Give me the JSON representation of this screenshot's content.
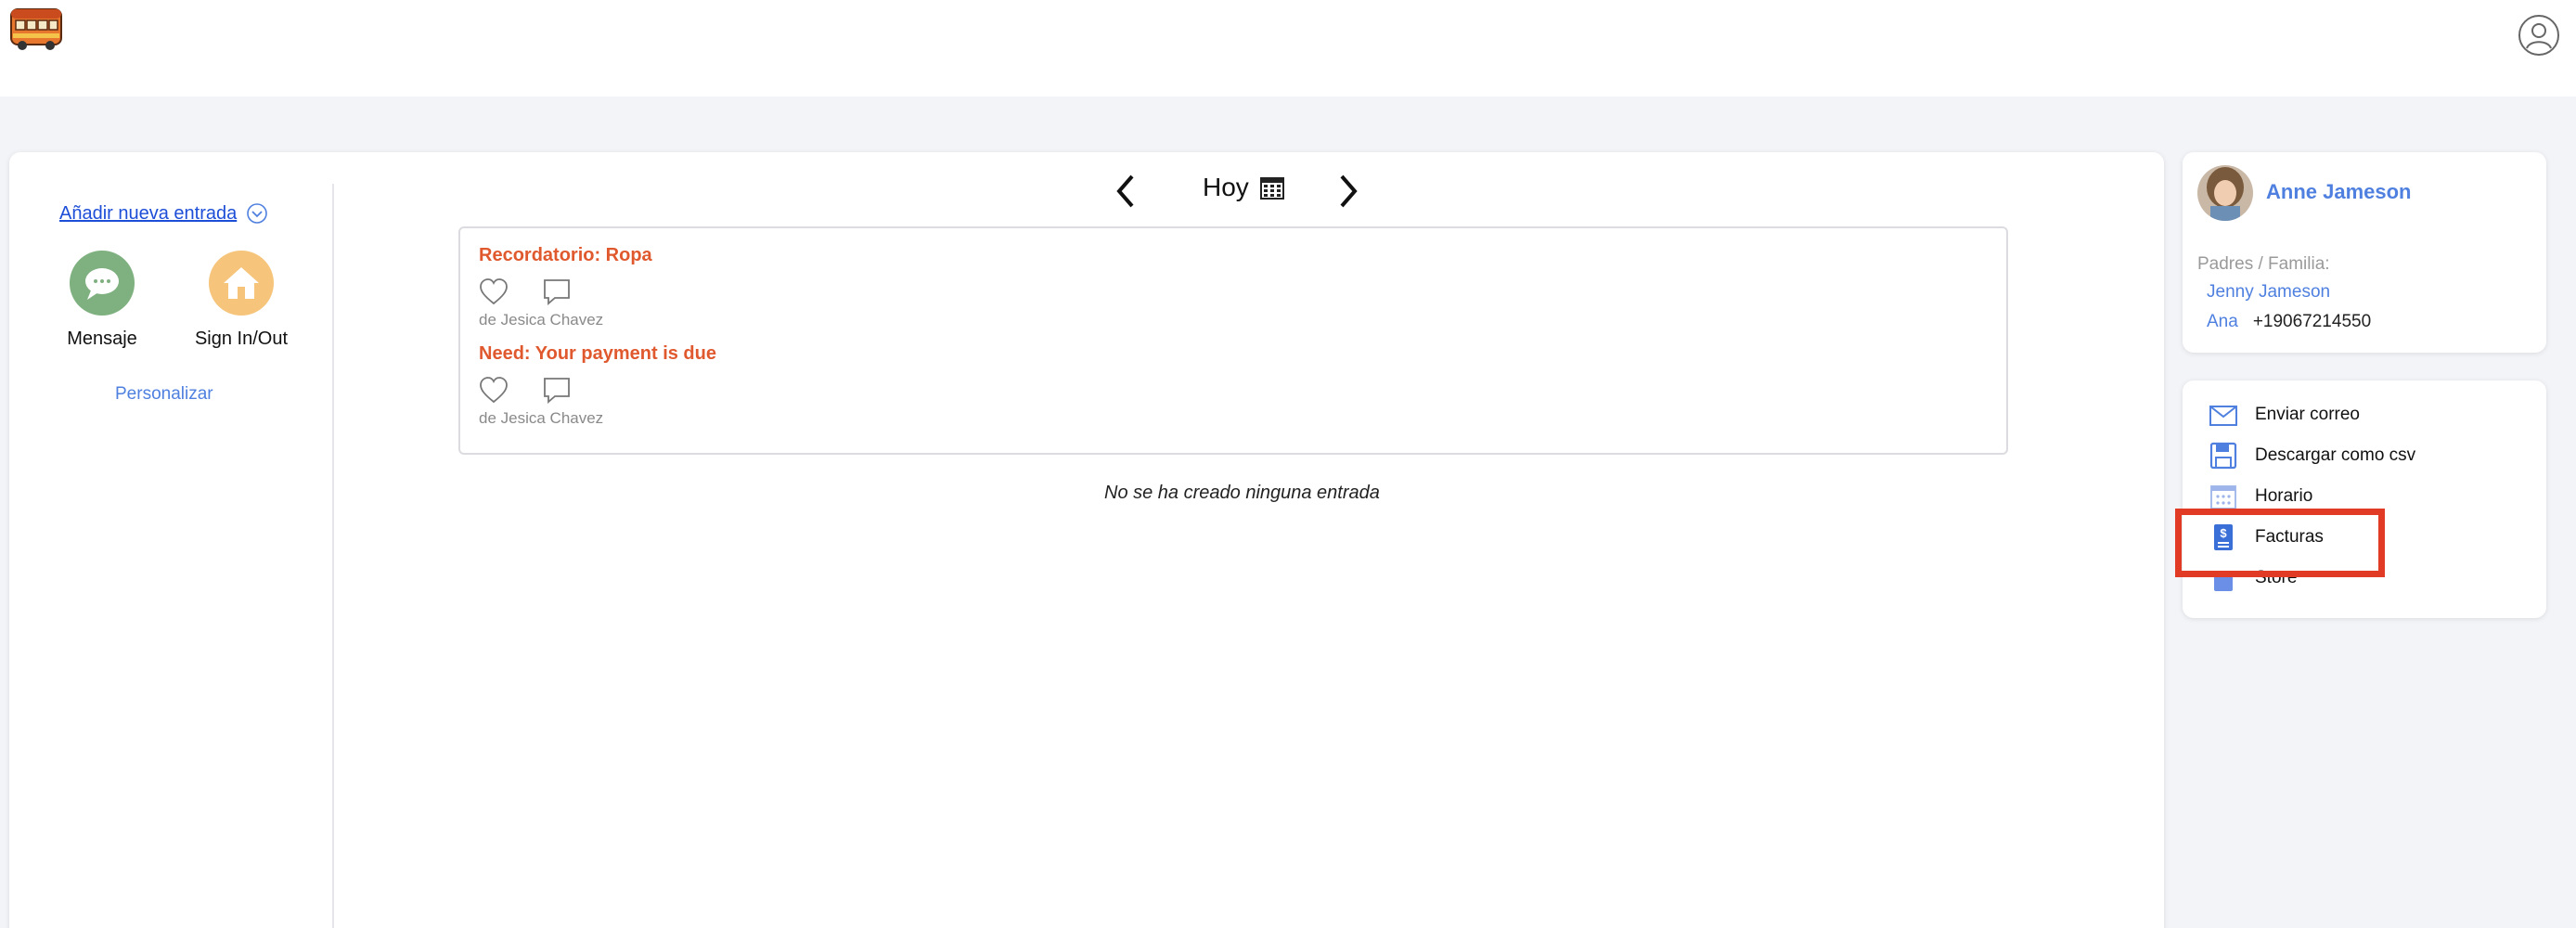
{
  "header": {
    "logo_icon": "school-bus-logo-icon",
    "user_icon": "user-profile-icon"
  },
  "left": {
    "add_entry_label": "Añadir nueva entrada",
    "quick_actions": [
      {
        "label": "Mensaje",
        "icon": "chat-bubble-icon",
        "color": "#7fb07f"
      },
      {
        "label": "Sign In/Out",
        "icon": "home-icon",
        "color": "#f6c47a"
      }
    ],
    "personalize_label": "Personalizar"
  },
  "date_nav": {
    "today_label": "Hoy"
  },
  "feed": {
    "entries": [
      {
        "title": "Recordatorio: Ropa",
        "byline": "de Jesica Chavez"
      },
      {
        "title": "Need: Your payment is due",
        "byline": "de Jesica Chavez"
      }
    ],
    "empty_note": "No se ha creado ninguna entrada"
  },
  "profile": {
    "name": "Anne Jameson",
    "family_label": "Padres / Familia:",
    "parents": [
      {
        "name": "Jenny Jameson",
        "phone": ""
      },
      {
        "name": "Ana",
        "phone": "+19067214550"
      }
    ]
  },
  "actions_menu": {
    "items": [
      {
        "label": "Enviar correo",
        "icon": "envelope-icon"
      },
      {
        "label": "Descargar como csv",
        "icon": "save-disk-icon"
      },
      {
        "label": "Horario",
        "icon": "calendar-icon"
      },
      {
        "label": "Facturas",
        "icon": "invoice-dollar-icon"
      },
      {
        "label": "Store",
        "icon": "store-icon"
      }
    ]
  },
  "colors": {
    "accent_blue": "#4f80e0",
    "entry_title": "#e0592e",
    "highlight": "#e23b25"
  }
}
